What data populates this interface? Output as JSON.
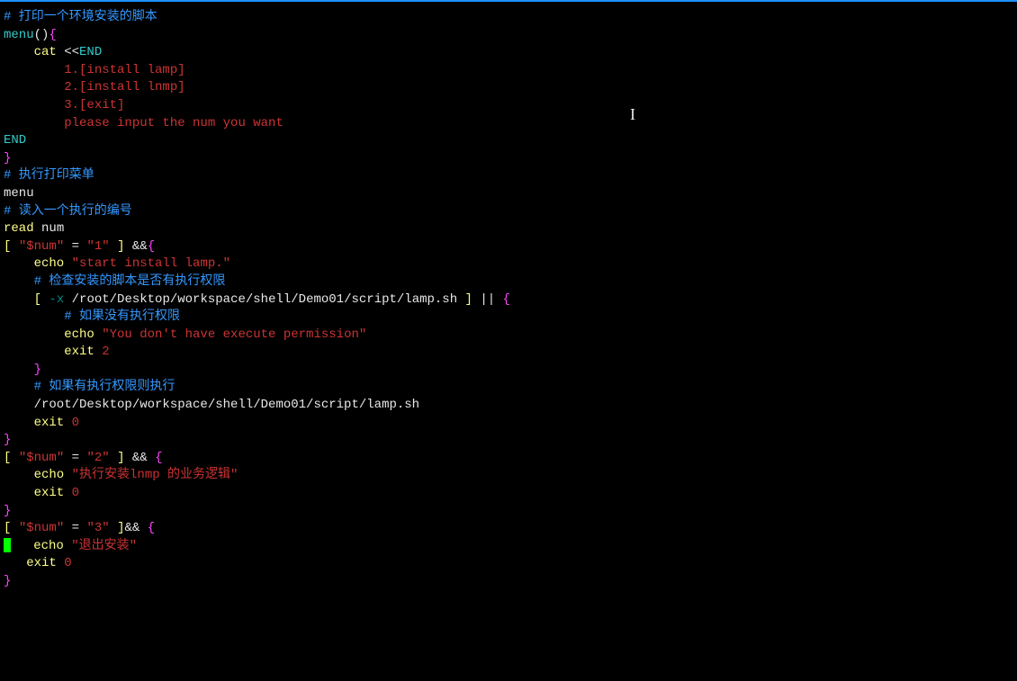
{
  "lines": {
    "l01": "# 打印一个环境安装的脚本",
    "l02a": "menu",
    "l02b": "()",
    "l02c": "{",
    "l03a": "    cat ",
    "l03b": "<<",
    "l03c": "END",
    "l04": "        1.[install lamp]",
    "l05": "        2.[install lnmp]",
    "l06": "        3.[exit]",
    "l07": "        please input the num you want",
    "l08": "END",
    "l09": "}",
    "l10": "# 执行打印菜单",
    "l11": "menu",
    "l12": "",
    "l13": "# 读入一个执行的编号",
    "l14a": "read",
    "l14b": " num",
    "l15a": "[",
    "l15b": " ",
    "l15c": "\"$num\"",
    "l15d": " ",
    "l15e": "=",
    "l15f": " ",
    "l15g": "\"1\"",
    "l15h": " ",
    "l15i": "]",
    "l15j": " ",
    "l15k": "&&",
    "l15l": "{",
    "l16a": "    echo ",
    "l16b": "\"start install lamp.\"",
    "l17": "    # 检查安装的脚本是否有执行权限",
    "l18a": "    ",
    "l18b": "[",
    "l18c": " ",
    "l18d": "-x",
    "l18e": " /root/Desktop/workspace/shell/Demo01/script/lamp.sh ",
    "l18f": "]",
    "l18g": " ",
    "l18h": "||",
    "l18i": " ",
    "l18j": "{",
    "l19": "        # 如果没有执行权限",
    "l20a": "        echo ",
    "l20b": "\"You don't have execute permission\"",
    "l21a": "        exit ",
    "l21b": "2",
    "l22": "    }",
    "l23": "    # 如果有执行权限则执行",
    "l24": "    /root/Desktop/workspace/shell/Demo01/script/lamp.sh",
    "l25a": "    exit ",
    "l25b": "0",
    "l26": "}",
    "l27": "",
    "l28a": "[",
    "l28b": " ",
    "l28c": "\"$num\"",
    "l28d": " ",
    "l28e": "=",
    "l28f": " ",
    "l28g": "\"2\"",
    "l28h": " ",
    "l28i": "]",
    "l28j": " ",
    "l28k": "&&",
    "l28l": " ",
    "l28m": "{",
    "l29": "",
    "l30a": "    echo ",
    "l30b": "\"执行安装lnmp 的业务逻辑\"",
    "l31a": "    exit ",
    "l31b": "0",
    "l32": "}",
    "l33": "",
    "l34a": "[",
    "l34b": " ",
    "l34c": "\"$num\"",
    "l34d": " ",
    "l34e": "=",
    "l34f": " ",
    "l34g": "\"3\"",
    "l34h": " ",
    "l34i": "]",
    "l34j": "&&",
    "l34k": " ",
    "l34l": "{",
    "l35": "",
    "l36a": "   echo ",
    "l36b": "\"退出安装\"",
    "l37a": "   exit ",
    "l37b": "0",
    "l38": "}"
  },
  "cursor": "I"
}
